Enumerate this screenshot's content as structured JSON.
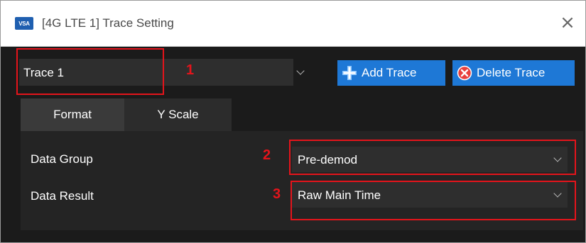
{
  "window": {
    "icon_label": "VSA",
    "title": "[4G LTE 1] Trace Setting",
    "close_glyph": "×"
  },
  "trace": {
    "selected": "Trace 1"
  },
  "toolbar": {
    "add_label": "Add Trace",
    "delete_label": "Delete Trace"
  },
  "tabs": [
    {
      "label": "Format",
      "active": true
    },
    {
      "label": "Y Scale",
      "active": false
    }
  ],
  "format": {
    "data_group_label": "Data Group",
    "data_group_value": "Pre-demod",
    "data_result_label": "Data Result",
    "data_result_value": "Raw Main Time"
  },
  "annotations": [
    "1",
    "2",
    "3"
  ],
  "colors": {
    "accent": "#1e78d6",
    "annotation": "#e5141b",
    "background": "#1b1b1b"
  },
  "icons": {
    "add": "plus-icon",
    "delete": "delete-circle-icon",
    "dropdown": "chevron-down-icon",
    "close": "close-icon"
  }
}
